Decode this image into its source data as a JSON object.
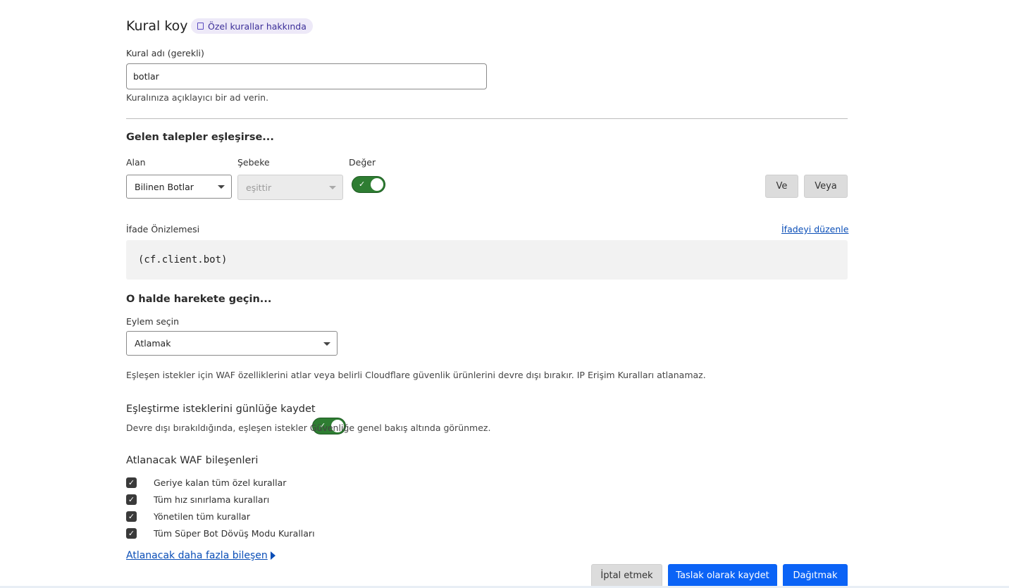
{
  "header": {
    "title": "Kural koy",
    "about_link": "Özel kurallar hakkında"
  },
  "rule_name": {
    "label": "Kural adı (gerekli)",
    "value": "botlar",
    "hint": "Kuralınıza açıklayıcı bir ad verin."
  },
  "match": {
    "heading": "Gelen talepler eşleşirse...",
    "field_label": "Alan",
    "field_value": "Bilinen Botlar",
    "operator_label": "Şebeke",
    "operator_value": "eşittir",
    "value_label": "Değer",
    "value_toggle_on": true,
    "and_button": "Ve",
    "or_button": "Veya"
  },
  "expression": {
    "label": "İfade Önizlemesi",
    "edit_link": "İfadeyi düzenle",
    "code": "(cf.client.bot)"
  },
  "action": {
    "heading": "O halde harekete geçin...",
    "select_label": "Eylem seçin",
    "select_value": "Atlamak",
    "description": "Eşleşen istekler için WAF özelliklerini atlar veya belirli Cloudflare güvenlik ürünlerini devre dışı bırakır. IP Erişim Kuralları atlanamaz."
  },
  "logging": {
    "label": "Eşleştirme isteklerini günlüğe kaydet",
    "toggle_on": true,
    "hint": "Devre dışı bırakıldığında, eşleşen istekler Güvenliğe genel bakış altında görünmez."
  },
  "waf": {
    "heading": "Atlanacak WAF bileşenleri",
    "items": [
      {
        "label": "Geriye kalan tüm özel kurallar",
        "checked": true
      },
      {
        "label": "Tüm hız sınırlama kuralları",
        "checked": true
      },
      {
        "label": "Yönetilen tüm kurallar",
        "checked": true
      },
      {
        "label": "Tüm Süper Bot Dövüş Modu Kuralları",
        "checked": true
      }
    ],
    "more_link": "Atlanacak daha fazla bileşen"
  },
  "footer": {
    "cancel": "İptal etmek",
    "save_draft": "Taslak olarak kaydet",
    "deploy": "Dağıtmak"
  },
  "colors": {
    "accent_blue": "#0b63f6",
    "toggle_green": "#2e7d32",
    "pill_bg": "#ede9f8"
  }
}
